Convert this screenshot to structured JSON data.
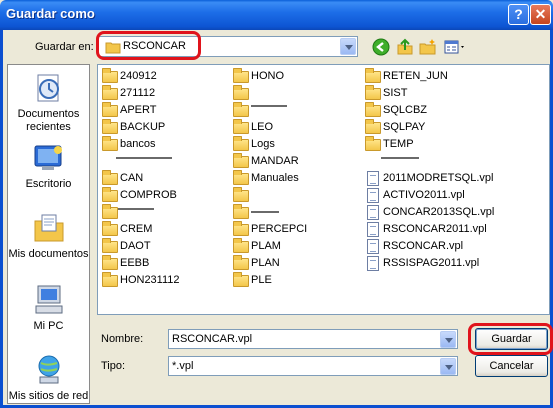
{
  "window": {
    "title": "Guardar como",
    "help_glyph": "?",
    "close_glyph": "✕"
  },
  "lookin": {
    "label": "Guardar en:",
    "value": "RSCONCAR"
  },
  "toolbar": {
    "icons": [
      "back-icon",
      "up-folder-icon",
      "new-folder-icon",
      "views-menu-icon"
    ]
  },
  "places": [
    {
      "label": "Documentos recientes",
      "icon": "recent-documents-icon"
    },
    {
      "label": "Escritorio",
      "icon": "desktop-icon"
    },
    {
      "label": "Mis documentos",
      "icon": "my-documents-icon"
    },
    {
      "label": "Mi PC",
      "icon": "my-computer-icon"
    },
    {
      "label": "Mis sitios de red",
      "icon": "network-places-icon"
    }
  ],
  "files": {
    "col1": [
      "240912",
      "271112",
      "APERT",
      "BACKUP",
      "bancos",
      "",
      "CAN",
      "COMPROB",
      "",
      "CREM",
      "DAOT",
      "EEBB",
      "HON231112"
    ],
    "col2": [
      "HONO",
      "",
      "",
      "LEO",
      "Logs",
      "MANDAR",
      "Manuales",
      "",
      "",
      "PERCEPCI",
      "PLAM",
      "PLAN",
      "PLE"
    ],
    "col3": [
      "RETEN_JUN",
      "SIST",
      "SQLCBZ",
      "SQLPAY",
      "TEMP",
      "",
      "2011MODRETSQL.vpl",
      "ACTIVO2011.vpl",
      "CONCAR2013SQL.vpl",
      "RSCONCAR2011.vpl",
      "RSCONCAR.vpl",
      "RSSISPAG2011.vpl"
    ]
  },
  "form": {
    "nombre_label": "Nombre:",
    "nombre_value": "RSCONCAR.vpl",
    "tipo_label": "Tipo:",
    "tipo_value": "*.vpl"
  },
  "buttons": {
    "save": "Guardar",
    "cancel": "Cancelar"
  },
  "colors": {
    "titlebar": "#0d55d3",
    "highlight": "#e0141c",
    "dialog_bg": "#ece9d8"
  }
}
